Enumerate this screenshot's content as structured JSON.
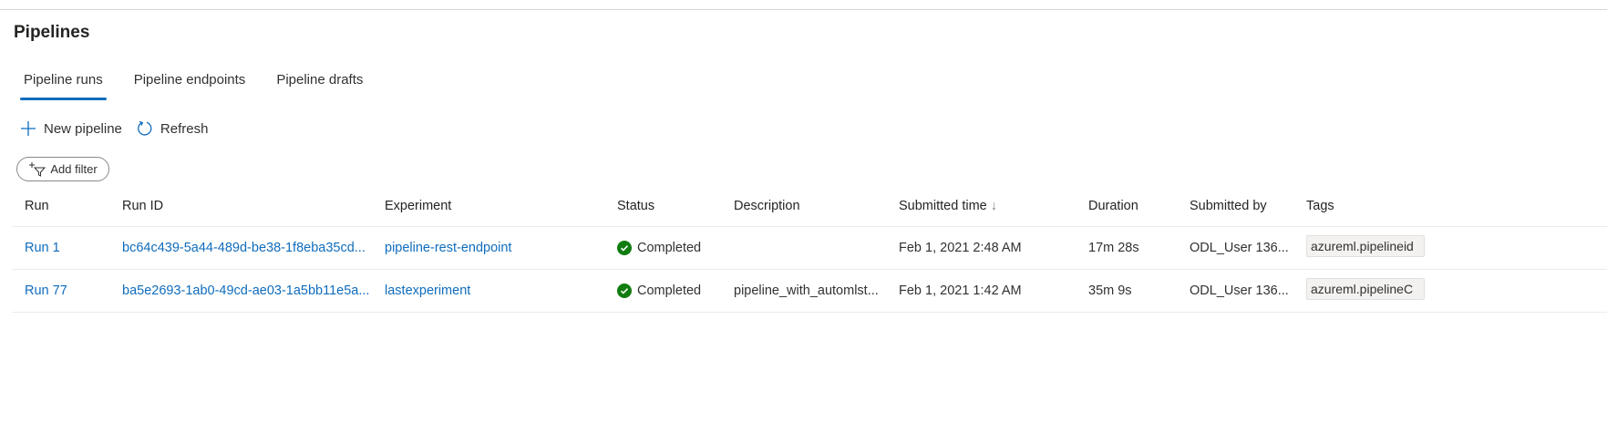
{
  "title": "Pipelines",
  "tabs": [
    {
      "label": "Pipeline runs"
    },
    {
      "label": "Pipeline endpoints"
    },
    {
      "label": "Pipeline drafts"
    }
  ],
  "toolbar": {
    "new_pipeline": "New pipeline",
    "refresh": "Refresh",
    "add_filter": "Add filter"
  },
  "columns": {
    "run": "Run",
    "run_id": "Run ID",
    "experiment": "Experiment",
    "status": "Status",
    "description": "Description",
    "submitted_time": "Submitted time",
    "sort_indicator": "↓",
    "duration": "Duration",
    "submitted_by": "Submitted by",
    "tags": "Tags"
  },
  "rows": [
    {
      "run": "Run 1",
      "run_id": "bc64c439-5a44-489d-be38-1f8eba35cd...",
      "experiment": "pipeline-rest-endpoint",
      "status": "Completed",
      "description": "",
      "submitted_time": "Feb 1, 2021 2:48 AM",
      "duration": "17m 28s",
      "submitted_by": "ODL_User 136...",
      "tag": "azureml.pipelineid"
    },
    {
      "run": "Run 77",
      "run_id": "ba5e2693-1ab0-49cd-ae03-1a5bb11e5a...",
      "experiment": "lastexperiment",
      "status": "Completed",
      "description": "pipeline_with_automlst...",
      "submitted_time": "Feb 1, 2021 1:42 AM",
      "duration": "35m 9s",
      "submitted_by": "ODL_User 136...",
      "tag": "azureml.pipelineC"
    }
  ],
  "colors": {
    "accent": "#0f6cbd",
    "success": "#107c10"
  }
}
